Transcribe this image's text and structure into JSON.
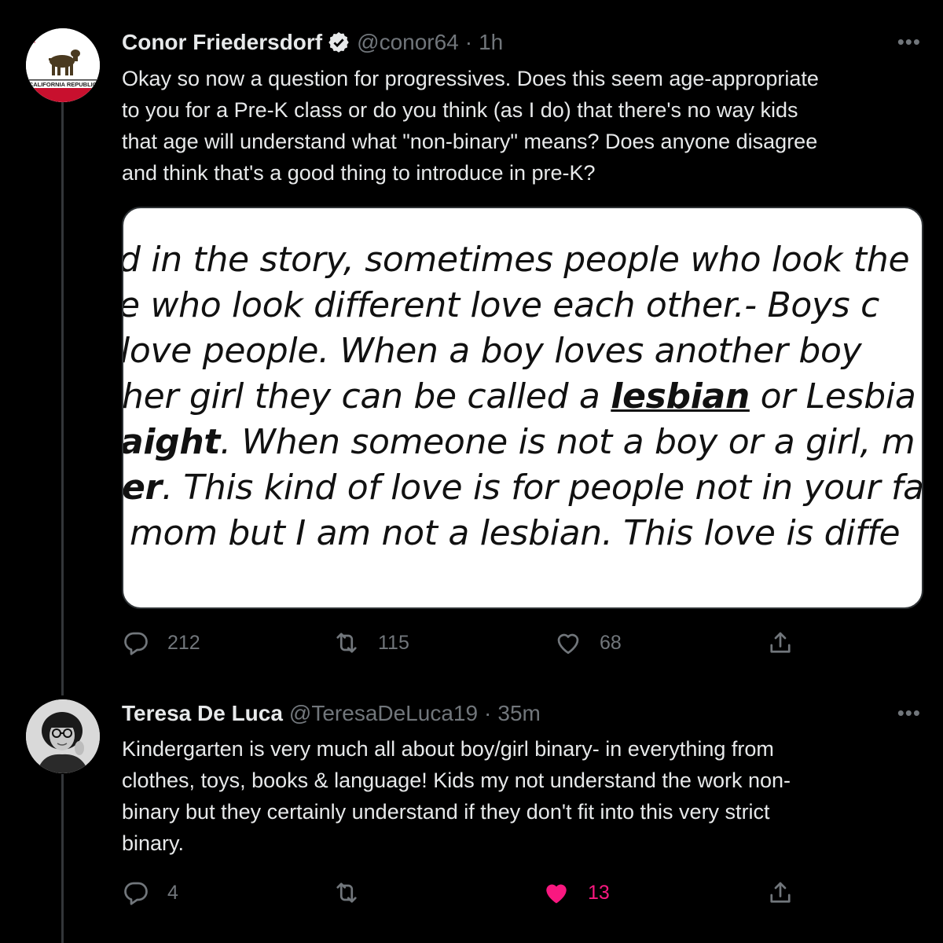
{
  "tweets": [
    {
      "author_name": "Conor Friedersdorf",
      "handle": "@conor64",
      "separator": "·",
      "time": "1h",
      "avatar_text": "CALIFORNIA REPUBLIC",
      "text_lines": [
        "Okay so now a question for progressives. Does this seem age-appropriate",
        "to you for a Pre-K class or do you think (as I do) that there's no way kids",
        "that age will understand what \"non-binary\" means? Does anyone disagree",
        "and think that's a good thing to introduce in pre-K?"
      ],
      "media_lines": {
        "l1": "d in the story, sometimes people who look the",
        "l2": "e who look different love each other.- Boys c",
        "l3": "love people. When a boy loves another boy",
        "l4_a": "her girl they can be called a ",
        "l4_b": "lesbian",
        "l4_c": " or Lesbia",
        "l5_a": "aight",
        "l5_b": ". When someone is not a boy or a girl, m",
        "l6_a": "er",
        "l6_b": ". This kind of love is for people not in your fa",
        "l7": "mom but I am not a lesbian.  This love is diffe"
      },
      "replies": "212",
      "retweets": "115",
      "likes": "68",
      "more": "•••"
    },
    {
      "author_name": "Teresa De Luca",
      "handle": "@TeresaDeLuca19",
      "separator": "·",
      "time": "35m",
      "text_lines": [
        "Kindergarten is very much all about boy/girl binary- in everything from",
        "clothes, toys, books & language! Kids my not understand the work non-",
        "binary but they certainly understand if they don't fit into this very strict",
        "binary."
      ],
      "replies": "4",
      "retweets": "",
      "likes": "13",
      "more": "•••"
    }
  ],
  "colors": {
    "background": "#000000",
    "text": "#e7e9ea",
    "muted": "#71767b",
    "like_active": "#f91880",
    "verified": "#e7e9ea"
  },
  "icons": [
    "reply-icon",
    "retweet-icon",
    "like-icon",
    "share-icon",
    "verified-badge-icon",
    "more-icon"
  ]
}
